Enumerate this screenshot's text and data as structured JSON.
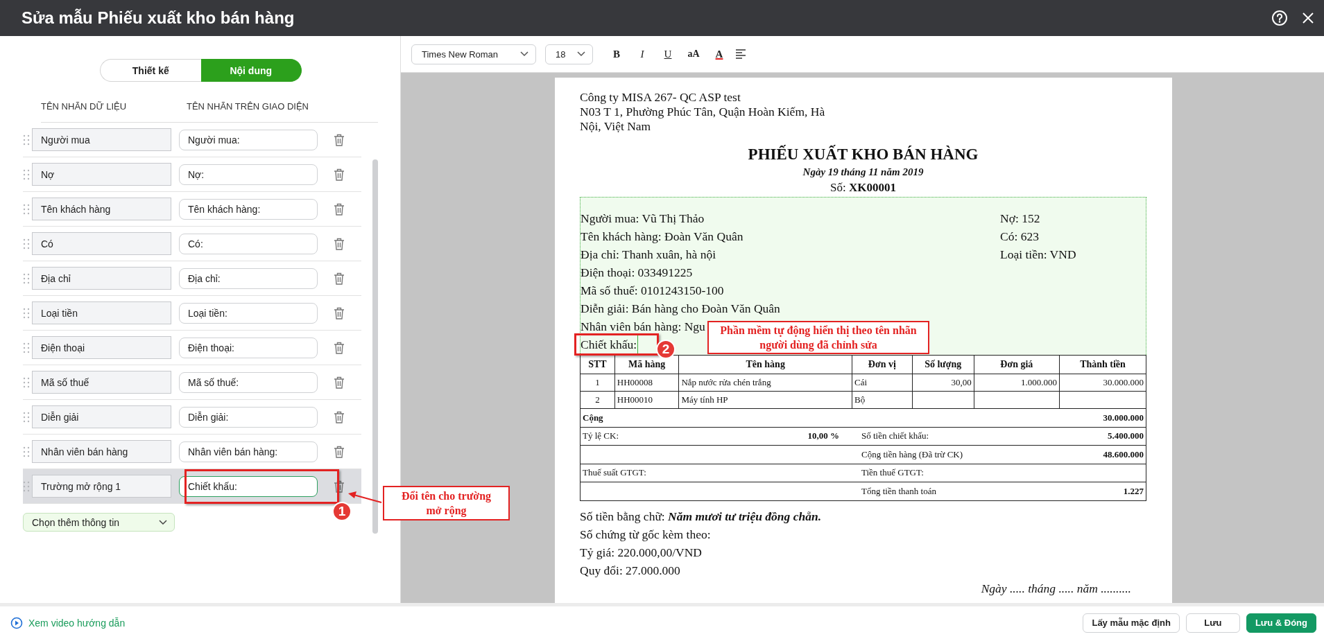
{
  "window": {
    "title": "Sửa mẫu Phiếu xuất kho bán hàng"
  },
  "mode_tabs": [
    {
      "label": "Thiết kế",
      "selected": false
    },
    {
      "label": "Nội dung",
      "selected": true
    }
  ],
  "columns": [
    "TÊN NHÃN DỮ LIỆU",
    "TÊN NHÃN TRÊN GIAO DIỆN"
  ],
  "fields": [
    {
      "data_label": "Người mua",
      "display_label": "Người mua:",
      "selected": false
    },
    {
      "data_label": "Nợ",
      "display_label": "Nợ:",
      "selected": false
    },
    {
      "data_label": "Tên khách hàng",
      "display_label": "Tên khách hàng:",
      "selected": false
    },
    {
      "data_label": "Có",
      "display_label": "Có:",
      "selected": false
    },
    {
      "data_label": "Địa chỉ",
      "display_label": "Địa chỉ:",
      "selected": false
    },
    {
      "data_label": "Loại tiền",
      "display_label": "Loại tiền:",
      "selected": false
    },
    {
      "data_label": "Điện thoại",
      "display_label": "Điện thoại:",
      "selected": false
    },
    {
      "data_label": "Mã số thuế",
      "display_label": "Mã số thuế:",
      "selected": false
    },
    {
      "data_label": "Diễn giải",
      "display_label": "Diễn giải:",
      "selected": false
    },
    {
      "data_label": "Nhân viên bán hàng",
      "display_label": "Nhân viên bán hàng:",
      "selected": false
    },
    {
      "data_label": "Trường mở rộng 1",
      "display_label": "Chiết khấu:",
      "selected": true
    }
  ],
  "add_info": "Chọn thêm thông tin",
  "toolbar": {
    "font": "Times New Roman",
    "size": "18",
    "format_buttons": [
      {
        "kind": "bold",
        "label": "B"
      },
      {
        "kind": "italic",
        "label": "I"
      },
      {
        "kind": "underline",
        "label": "U"
      },
      {
        "kind": "case",
        "label": "aA"
      },
      {
        "kind": "color",
        "label": "A"
      }
    ]
  },
  "document": {
    "company_lines": [
      "Công ty MISA 267- QC ASP test",
      "N03 T 1, Phường Phúc Tân, Quận Hoàn Kiếm, Hà",
      "Nội, Việt Nam"
    ],
    "title": "PHIẾU XUẤT KHO BÁN HÀNG",
    "date": "Ngày 19 tháng 11 năm 2019",
    "number": "Số: **XK00001**",
    "info_left": [
      "Người mua: Vũ Thị Thảo",
      "Tên khách hàng: Đoàn Văn Quân",
      "Địa chỉ: Thanh xuân, hà nội",
      "Điện thoại: 033491225",
      "Mã số thuế: 0101243150-100",
      "Diễn giải: Bán hàng cho Đoàn Văn Quân",
      "Nhân viên bán hàng: Ngu",
      "Chiết khấu:"
    ],
    "info_right": [
      "Nợ: 152",
      "Có: 623",
      "Loại tiền: VND"
    ],
    "table": {
      "columns": [
        "STT",
        "Mã hàng",
        "Tên hàng",
        "Đơn vị",
        "Số lượng",
        "Đơn giá",
        "Thành tiền"
      ],
      "rows": [
        [
          "1",
          "HH00008",
          "Nắp nước rửa chén trắng",
          "Cái",
          "30,00",
          "1.000.000",
          "30.000.000"
        ],
        [
          "2",
          "HH00010",
          "Máy tính HP",
          "Bộ",
          "",
          "",
          ""
        ]
      ]
    },
    "summary": [
      {
        "kind": "total",
        "label": "Cộng",
        "value": "30.000.000"
      },
      {
        "kind": "split",
        "left_label": "Tỷ lệ CK:",
        "left_value": "10,00 %",
        "label": "Số tiền chiết khấu:",
        "value": "5.400.000"
      },
      {
        "kind": "split",
        "label": "Cộng tiền hàng (Đã trừ CK)",
        "value": "48.600.000"
      },
      {
        "kind": "split",
        "left_label": "Thuế suất GTGT:",
        "label": "Tiền thuế GTGT:"
      },
      {
        "kind": "split",
        "label": "Tổng tiền thanh toán",
        "value": "1.227"
      }
    ],
    "footer_lines": [
      "Số tiền bằng chữ: **Năm mươi tư triệu đồng chẵn.**",
      "Số chứng từ gốc kèm theo:",
      "Tỷ giá: 220.000,00/VND",
      "Quy đổi: 27.000.000"
    ],
    "sign_date": "Ngày ..... tháng ..... năm .........."
  },
  "video_link": "Xem video hướng dẫn",
  "buttons": [
    {
      "label": "Lấy mẫu mặc định",
      "primary": false
    },
    {
      "label": "Lưu",
      "primary": false
    },
    {
      "label": "Lưu & Đóng",
      "primary": true
    }
  ],
  "annotations": [
    {
      "step": "1",
      "note": "Đổi tên cho trường mở rộng"
    },
    {
      "step": "2",
      "note": "Phần mềm tự động hiển thị theo tên nhãn người dùng đã chỉnh sửa"
    }
  ]
}
